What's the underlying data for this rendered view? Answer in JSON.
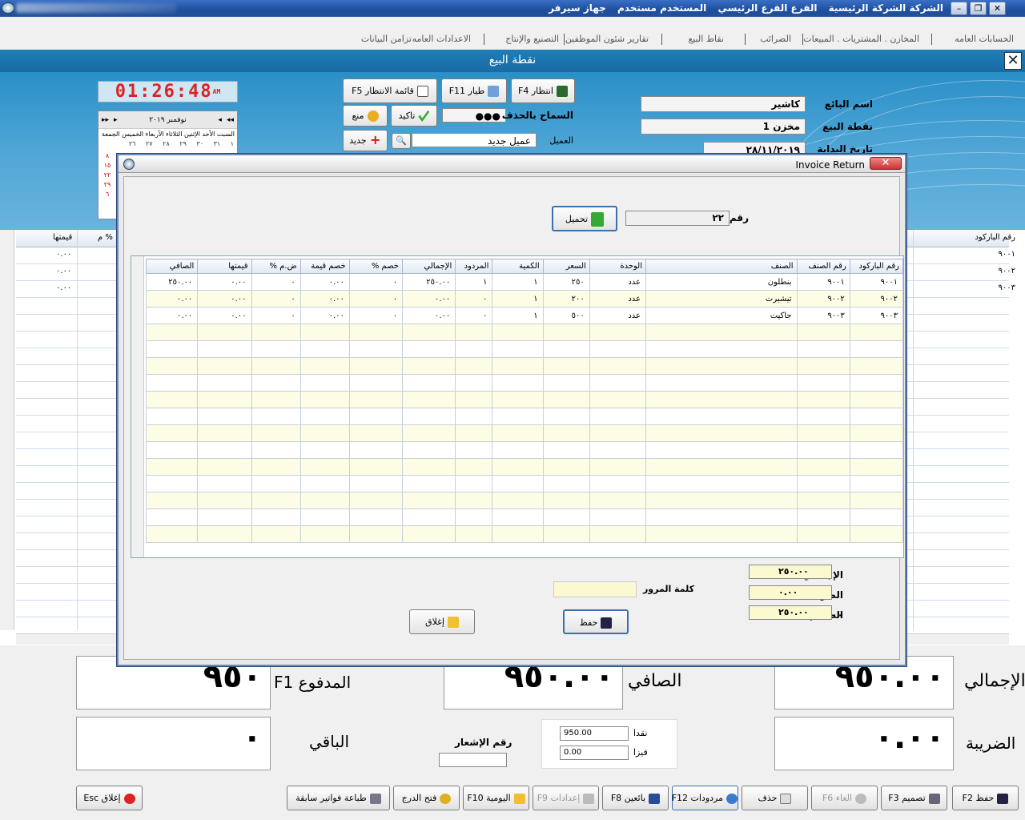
{
  "titlebar": {
    "items": [
      "الشركة الشركة الرئيسية",
      "الفرع الفرع الرئيسي",
      "المستخدم مستخدم",
      "جهاز سيرفر"
    ]
  },
  "menu": [
    "الحسابات العامه",
    "المخازن . المشتريات . المبيعات",
    "الضرائب",
    "نقاط البيع",
    "تقارير شئون الموظفين",
    "التصنيع والإنتاج",
    "الاعدادات العامه",
    "تزامن البيانات"
  ],
  "form": {
    "title": "نقطة البيع",
    "clock": "01:26:48",
    "clock_ampm": "AM",
    "calendar": {
      "month": "نوفمبر ٢٠١٩",
      "days": "السبت الأحد الإثنين الثلاثاء الأربعاء الخميس الجمعة",
      "row1": "١ ٣١ ٣٠ ٢٩ ٢٨ ٢٧ ٢٦",
      "week_col": [
        "١",
        "٨",
        "١٥",
        "٢٢",
        "٢٩",
        "٦"
      ]
    },
    "seller_label": "اسم البائع",
    "seller_value": "كاشير",
    "pos_label": "نقطة البيع",
    "pos_value": "مخزن 1",
    "start_date_label": "تاريخ البداية",
    "start_date_value": "٢٨/١١/٢٠١٩",
    "allow_delete_label": "السماح بالحذف",
    "allow_delete_value": "●●●",
    "customer_label": "العميل",
    "customer_value": "عميل جديد",
    "btn_wait": "انتظار F4",
    "btn_flight": "طيار F11",
    "btn_waitlist": "قائمة الانتظار F5",
    "btn_confirm": "تاكيد",
    "btn_prevent": "منع",
    "btn_new": "جديد"
  },
  "main_grid": {
    "headers": [
      "رقم الباركود",
      "",
      "قيمتها"
    ],
    "percent_header": "م %",
    "rows": [
      {
        "barcode": "٩٠٠١",
        "value": "٠.٠٠"
      },
      {
        "barcode": "٩٠٠٢",
        "value": "٠.٠٠"
      },
      {
        "barcode": "٩٠٠٣",
        "value": "٠.٠٠"
      }
    ]
  },
  "totals": {
    "total_label": "الإجمالي",
    "total_value": "٩٥٠.٠٠",
    "net_label": "الصافي",
    "net_value": "٩٥٠.٠٠",
    "paid_label": "المدفوع F1",
    "paid_value": "٩٥٠",
    "tax_label": "الضريبة",
    "tax_value": "٠.٠٠",
    "rest_label": "الباقي",
    "rest_value": "٠",
    "notice_label": "رقم الإشعار",
    "cash_label": "نقدا",
    "cash_value": "950.00",
    "visa_label": "فيزا",
    "visa_value": "0.00"
  },
  "toolbar": [
    {
      "label": "حفظ F2",
      "icon": "save-icon",
      "enabled": true
    },
    {
      "label": "تصميم F3",
      "icon": "printer-icon",
      "enabled": true
    },
    {
      "label": "الغاء F6",
      "icon": "cancel-icon",
      "enabled": false
    },
    {
      "label": "حذف",
      "icon": "delete-icon",
      "enabled": true
    },
    {
      "label": "مردودات F12",
      "icon": "returns-icon",
      "enabled": true
    },
    {
      "label": "بائعين F8",
      "icon": "users-icon",
      "enabled": true
    },
    {
      "label": "إعدادات F9",
      "icon": "settings-icon",
      "enabled": false
    },
    {
      "label": "اليومية F10",
      "icon": "folder-icon",
      "enabled": true
    },
    {
      "label": "فتح الدرج",
      "icon": "key-icon",
      "enabled": true
    },
    {
      "label": "طباعة فواتير سابقة",
      "icon": "printer-icon",
      "enabled": true
    },
    {
      "label": "إغلاق Esc",
      "icon": "close-icon",
      "enabled": true
    }
  ],
  "modal": {
    "title": "Invoice Return",
    "invoice_label": "رقم الفاتورة",
    "invoice_value": "٢٢",
    "load_button": "تحميل",
    "columns": [
      "رقم الباركود",
      "رقم الصنف",
      "الصنف",
      "الوحدة",
      "السعر",
      "الكمية",
      "المردود",
      "الإجمالي",
      "خصم %",
      "خصم قيمة",
      "ض.م %",
      "قيمتها",
      "الصافي"
    ],
    "rows": [
      [
        "٩٠٠١",
        "٩٠٠١",
        "بنطلون",
        "عدد",
        "٢٥٠",
        "١",
        "١",
        "٢٥٠.٠٠",
        "٠",
        "٠.٠٠",
        "٠",
        "٠.٠٠",
        "٢٥٠.٠٠"
      ],
      [
        "٩٠٠٢",
        "٩٠٠٢",
        "تيشيرت",
        "عدد",
        "٢٠٠",
        "١",
        "٠",
        "٠.٠٠",
        "٠",
        "٠.٠٠",
        "٠",
        "٠.٠٠",
        "٠.٠٠"
      ],
      [
        "٩٠٠٣",
        "٩٠٠٣",
        "جاكيت",
        "عدد",
        "٥٠٠",
        "١",
        "٠",
        "٠.٠٠",
        "٠",
        "٠.٠٠",
        "٠",
        "٠.٠٠",
        "٠.٠٠"
      ]
    ],
    "total_label": "الإجمالي",
    "total_value": "٢٥٠.٠٠",
    "tax_label": "الضريبة",
    "tax_value": "٠.٠٠",
    "net_label": "الصافي",
    "net_value": "٢٥٠.٠٠",
    "password_label": "كلمة المرور",
    "save_button": "حفظ",
    "close_button": "إغلاق"
  }
}
